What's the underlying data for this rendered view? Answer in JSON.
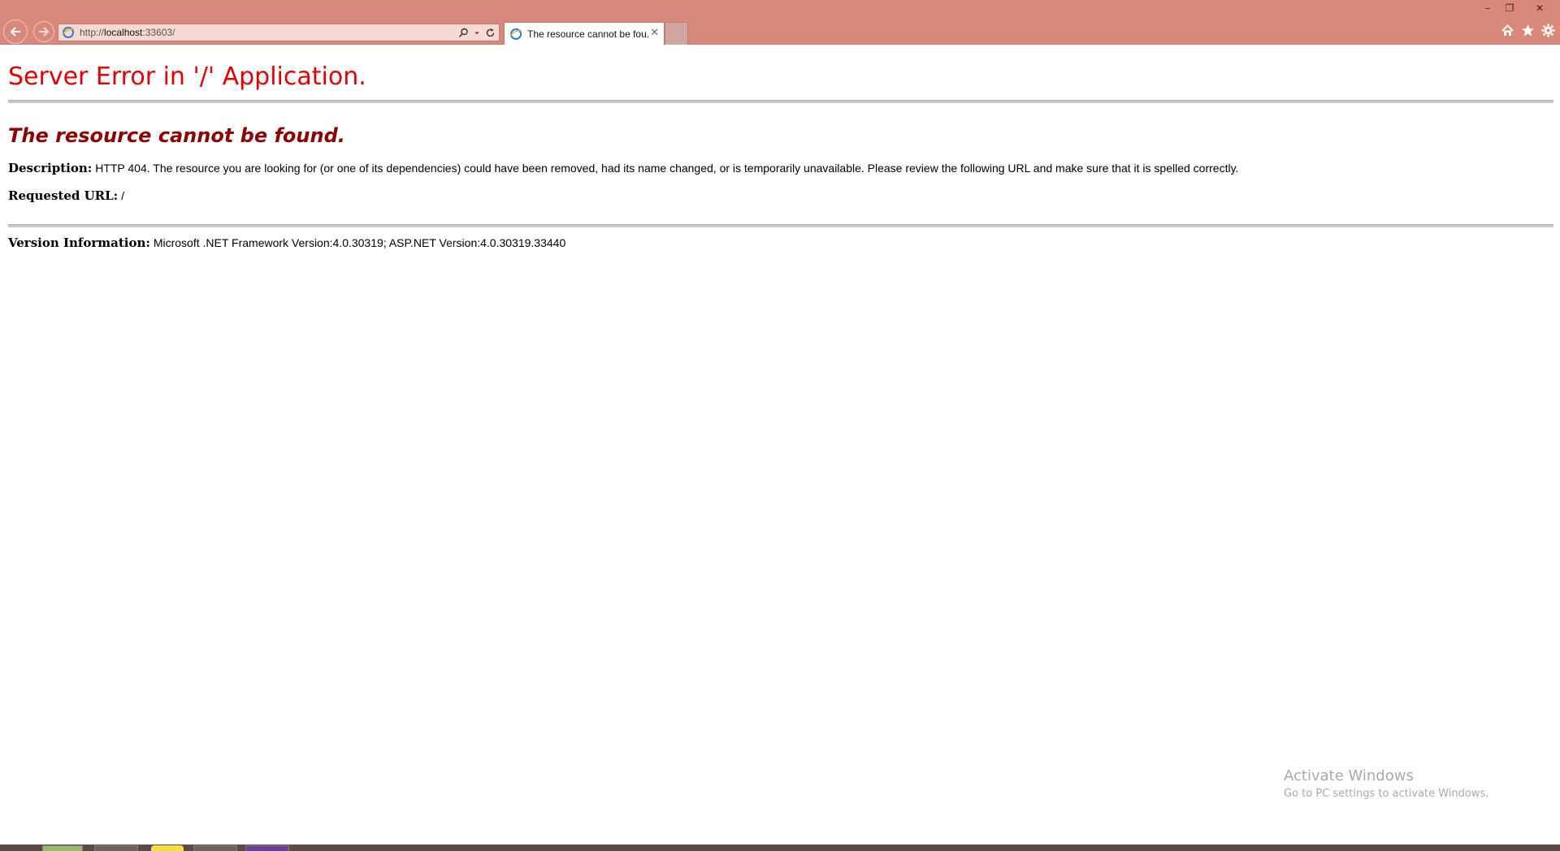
{
  "browser": {
    "address_bar": {
      "url_prefix": "http://",
      "url_host": "localhost",
      "url_rest": ":33603/"
    },
    "tab": {
      "title": "The resource cannot be fou...",
      "close_glyph": "✕"
    },
    "window_controls": {
      "minimize": "–",
      "restore": "❐",
      "close": "✕"
    },
    "icons": [
      "back-icon",
      "forward-icon",
      "ie-icon",
      "search-icon",
      "dropdown-icon",
      "refresh-icon",
      "home-icon",
      "favorites-star-icon",
      "settings-gear-icon"
    ],
    "colors": {
      "chrome": "#d9897b",
      "title_red": "#e00000",
      "heading_maroon": "#8b0000"
    }
  },
  "page": {
    "title": "Server Error in '/' Application.",
    "error_heading": "The resource cannot be found.",
    "description_label": "Description:",
    "description_text": "HTTP 404. The resource you are looking for (or one of its dependencies) could have been removed, had its name changed, or is temporarily unavailable.  Please review the following URL and make sure that it is spelled correctly.",
    "requested_url_label": "Requested URL:",
    "requested_url_value": "/",
    "version_label": "Version Information:",
    "version_text": "Microsoft .NET Framework Version:4.0.30319; ASP.NET Version:4.0.30319.33440"
  },
  "watermark": {
    "title": "Activate Windows",
    "subtitle": "Go to PC settings to activate Windows."
  }
}
